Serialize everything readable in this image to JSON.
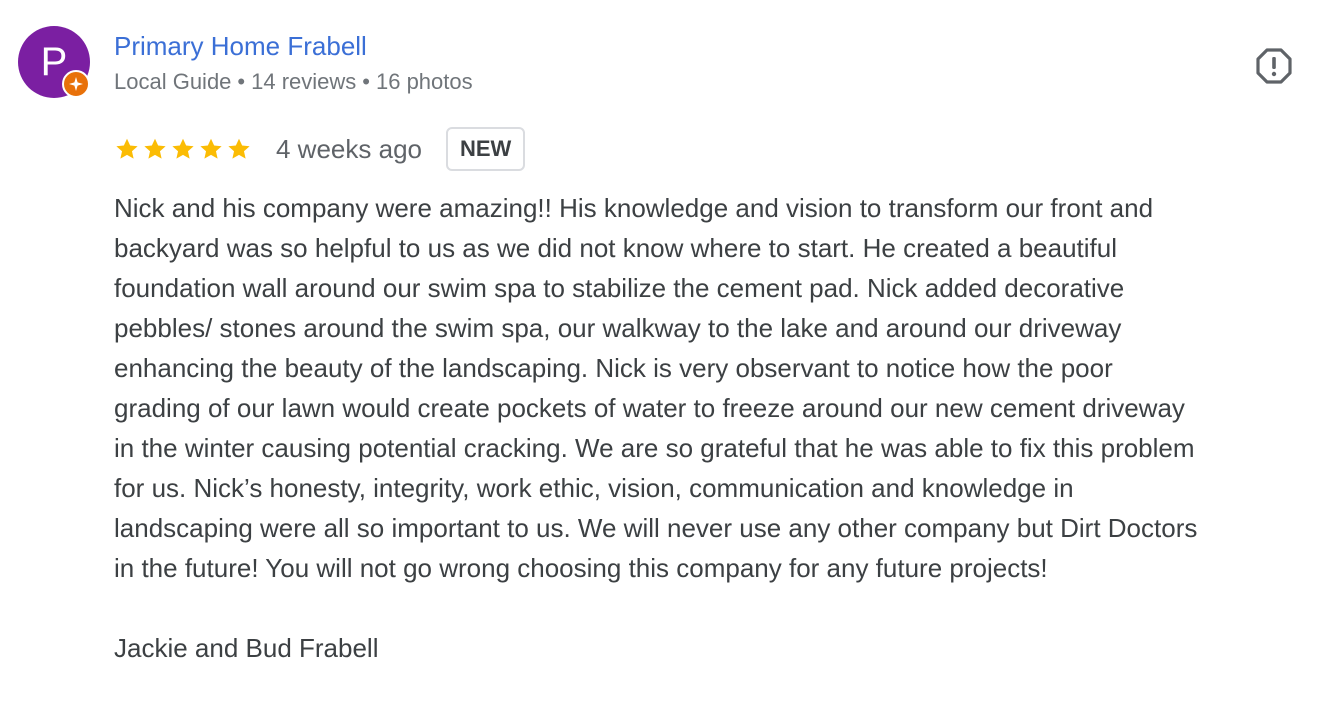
{
  "author": {
    "initial": "P",
    "avatar_color": "#7b1fa2",
    "badge_color": "#e8710a",
    "name": "Primary Home Frabell",
    "level": "Local Guide",
    "reviews": "14 reviews",
    "photos": "16 photos",
    "separator": "•"
  },
  "icons": {
    "flag": "report-flag-icon",
    "badge": "local-guide-star-icon",
    "star": "star-icon"
  },
  "rating": {
    "value": 5,
    "max": 5,
    "star_color": "#fbbc04",
    "time": "4 weeks ago",
    "badge": "NEW"
  },
  "review": {
    "lines": [
      "Nick and his company were amazing!! His knowledge and vision to transform our front and",
      "backyard was so helpful to us as we did not know where to start. He created a beautiful",
      "foundation wall around our swim spa to stabilize the cement pad. Nick added decorative",
      "pebbles/ stones around the swim spa, our walkway to the lake and around our driveway",
      "enhancing the beauty of the landscaping. Nick is very observant to notice how the poor",
      "grading of our lawn would create pockets of water to freeze around our new cement driveway",
      "in the winter causing potential cracking. We are so grateful that he was able to fix this problem",
      "for us. Nick’s honesty, integrity, work ethic, vision, communication and knowledge in",
      "landscaping were all so important to us. We will never use any other company but Dirt Doctors",
      "in the future! You will not go wrong choosing this company for any future projects!"
    ],
    "signature": "Jackie and Bud Frabell"
  }
}
